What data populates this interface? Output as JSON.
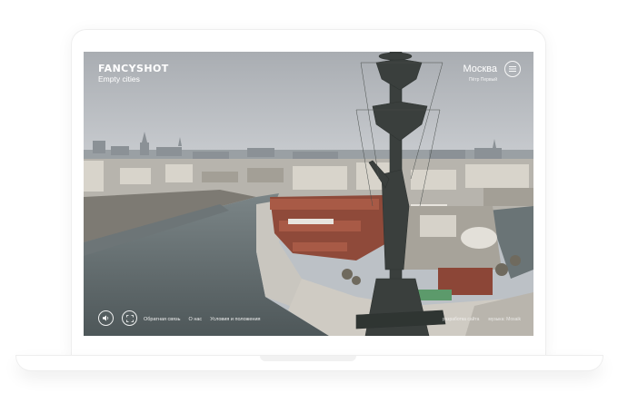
{
  "brand": {
    "name": "FANCYSHOT",
    "subtitle": "Empty cities"
  },
  "location": {
    "city": "Москва",
    "sub": "Пётр Первый"
  },
  "footer": {
    "links": [
      "Обратная связь",
      "О нас",
      "Условия и положения"
    ],
    "credits": [
      "разработка сайта",
      "музыка: Mosaik"
    ]
  },
  "icons": {
    "menu": "hamburger-icon",
    "sound": "speaker-icon",
    "fullscreen": "fullscreen-icon"
  },
  "colors": {
    "text": "#ffffff",
    "river": "#596264",
    "sky": "#b9bdc2"
  }
}
